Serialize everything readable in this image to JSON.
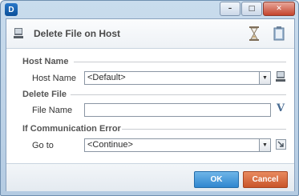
{
  "window": {
    "logo_letter": "D",
    "min": "–",
    "max": "□",
    "close": "✕"
  },
  "header": {
    "title": "Delete File on Host"
  },
  "sections": {
    "host": {
      "title": "Host Name",
      "field_label": "Host Name",
      "value": "<Default>"
    },
    "file": {
      "title": "Delete File",
      "field_label": "File Name",
      "value": ""
    },
    "comm": {
      "title": "If Communication Error",
      "field_label": "Go to",
      "value": "<Continue>"
    }
  },
  "footer": {
    "ok_label": "OK",
    "cancel_label": "Cancel"
  },
  "icons": {
    "variable": "V"
  },
  "colors": {
    "ok": "#3b8fd6",
    "cancel": "#d8612f",
    "accent": "#1a5fa8"
  }
}
